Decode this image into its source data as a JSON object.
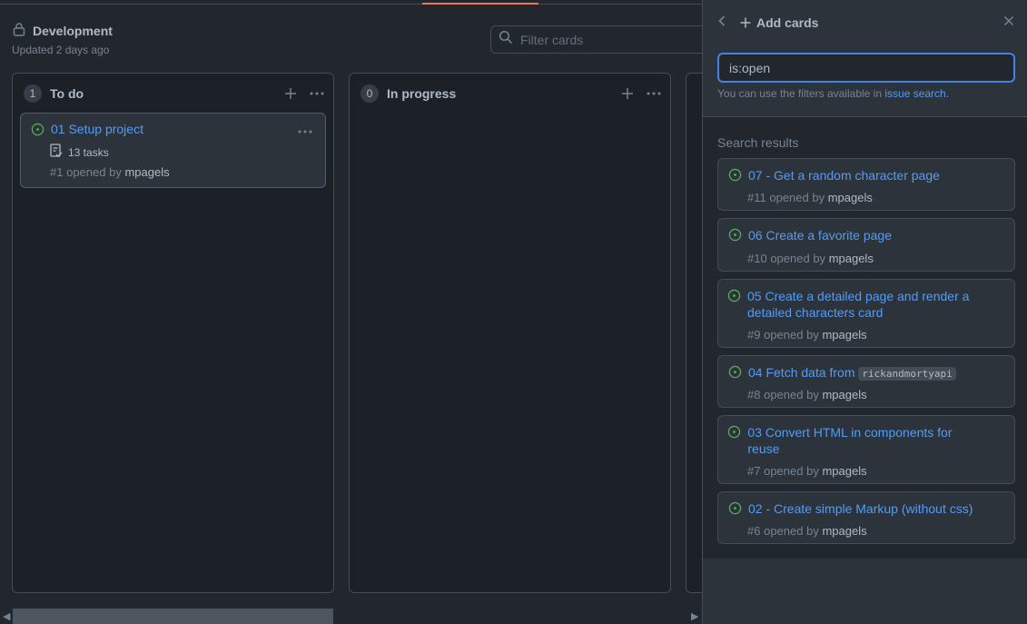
{
  "project": {
    "name": "Development",
    "updated": "Updated 2 days ago",
    "filter_placeholder": "Filter cards"
  },
  "columns": [
    {
      "count": "1",
      "name": "To do",
      "cards": [
        {
          "title": "01 Setup project",
          "tasks": "13 tasks",
          "number": "#1",
          "opened_by": "opened by",
          "user": "mpagels"
        }
      ]
    },
    {
      "count": "0",
      "name": "In progress",
      "cards": []
    }
  ],
  "panel": {
    "title": "Add cards",
    "search_value": "is:open",
    "hint_prefix": "You can use the filters available in",
    "hint_link": "issue search",
    "hint_suffix": ".",
    "results_label": "Search results",
    "results": [
      {
        "title": "07 - Get a random character page",
        "number": "#11",
        "opened_by": "opened by",
        "user": "mpagels"
      },
      {
        "title": "06 Create a favorite page",
        "number": "#10",
        "opened_by": "opened by",
        "user": "mpagels"
      },
      {
        "title": "05 Create a detailed page and render a detailed characters card",
        "number": "#9",
        "opened_by": "opened by",
        "user": "mpagels"
      },
      {
        "title_prefix": "04 Fetch data from",
        "title_code": "rickandmortyapi",
        "number": "#8",
        "opened_by": "opened by",
        "user": "mpagels"
      },
      {
        "title": "03 Convert HTML in components for reuse",
        "number": "#7",
        "opened_by": "opened by",
        "user": "mpagels"
      },
      {
        "title": "02 - Create simple Markup (without css)",
        "number": "#6",
        "opened_by": "opened by",
        "user": "mpagels"
      }
    ]
  },
  "colors": {
    "accent": "#539bf5",
    "open": "#57ab5a",
    "tab_highlight": "#ec775c"
  }
}
